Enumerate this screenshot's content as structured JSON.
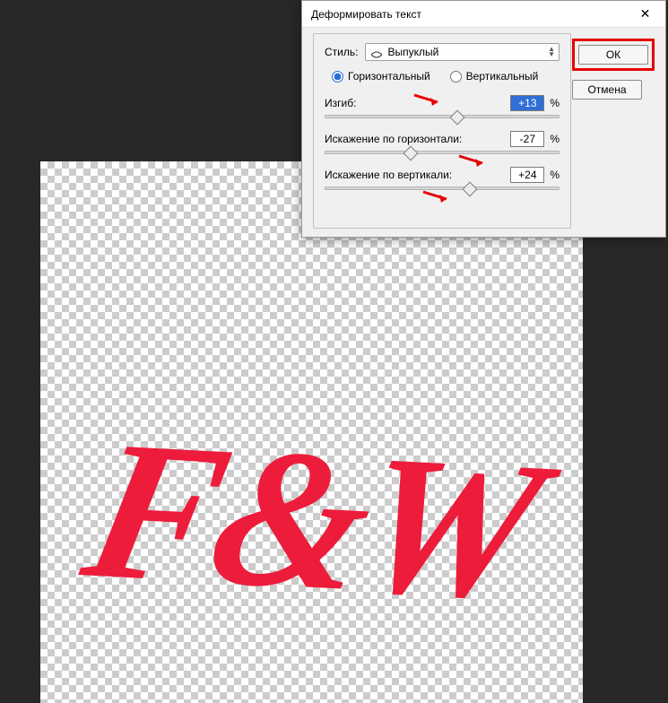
{
  "canvas": {
    "text": "F&W",
    "text_color": "#ed1c3a"
  },
  "dialog": {
    "title": "Деформировать текст",
    "close_glyph": "✕",
    "style_label": "Стиль:",
    "style_value": "Выпуклый",
    "orientation": {
      "horizontal_label": "Горизонтальный",
      "vertical_label": "Вертикальный",
      "selected": "horizontal"
    },
    "sliders": {
      "bend": {
        "label": "Изгиб:",
        "value_text": "+13",
        "value": 13,
        "min": -100,
        "max": 100,
        "unit": "%"
      },
      "h_distort": {
        "label": "Искажение по горизонтали:",
        "value_text": "-27",
        "value": -27,
        "min": -100,
        "max": 100,
        "unit": "%"
      },
      "v_distort": {
        "label": "Искажение по вертикали:",
        "value_text": "+24",
        "value": 24,
        "min": -100,
        "max": 100,
        "unit": "%"
      }
    },
    "buttons": {
      "ok": "ОК",
      "cancel": "Отмена"
    }
  }
}
